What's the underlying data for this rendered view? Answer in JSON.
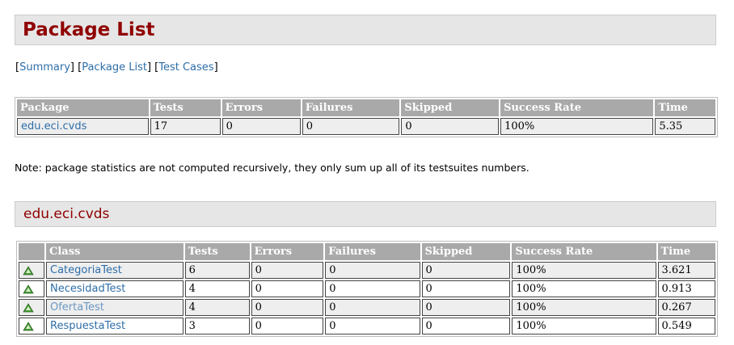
{
  "page": {
    "title": "Package List",
    "nav": {
      "summary": "Summary",
      "package_list": "Package List",
      "test_cases": "Test Cases"
    },
    "note": "Note: package statistics are not computed recursively, they only sum up all of its testsuites numbers."
  },
  "summary_table": {
    "headers": {
      "package": "Package",
      "tests": "Tests",
      "errors": "Errors",
      "failures": "Failures",
      "skipped": "Skipped",
      "success_rate": "Success Rate",
      "time": "Time"
    },
    "row": {
      "package": "edu.eci.cvds",
      "tests": "17",
      "errors": "0",
      "failures": "0",
      "skipped": "0",
      "success_rate": "100%",
      "time": "5.35"
    }
  },
  "package_section": {
    "title": "edu.eci.cvds"
  },
  "class_table": {
    "headers": {
      "class": "Class",
      "tests": "Tests",
      "errors": "Errors",
      "failures": "Failures",
      "skipped": "Skipped",
      "success_rate": "Success Rate",
      "time": "Time"
    },
    "status_icon": "success-icon",
    "rows": [
      {
        "class": "CategoriaTest",
        "tests": "6",
        "errors": "0",
        "failures": "0",
        "skipped": "0",
        "success_rate": "100%",
        "time": "3.621"
      },
      {
        "class": "NecesidadTest",
        "tests": "4",
        "errors": "0",
        "failures": "0",
        "skipped": "0",
        "success_rate": "100%",
        "time": "0.913"
      },
      {
        "class": "OfertaTest",
        "tests": "4",
        "errors": "0",
        "failures": "0",
        "skipped": "0",
        "success_rate": "100%",
        "time": "0.267"
      },
      {
        "class": "RespuestaTest",
        "tests": "3",
        "errors": "0",
        "failures": "0",
        "skipped": "0",
        "success_rate": "100%",
        "time": "0.549"
      }
    ]
  },
  "colors": {
    "heading": "#900000",
    "link": "#2e6ea8",
    "visited_link": "#6b98c4",
    "header_cell": "#a9a9a9",
    "section_bg": "#e6e6e6"
  }
}
